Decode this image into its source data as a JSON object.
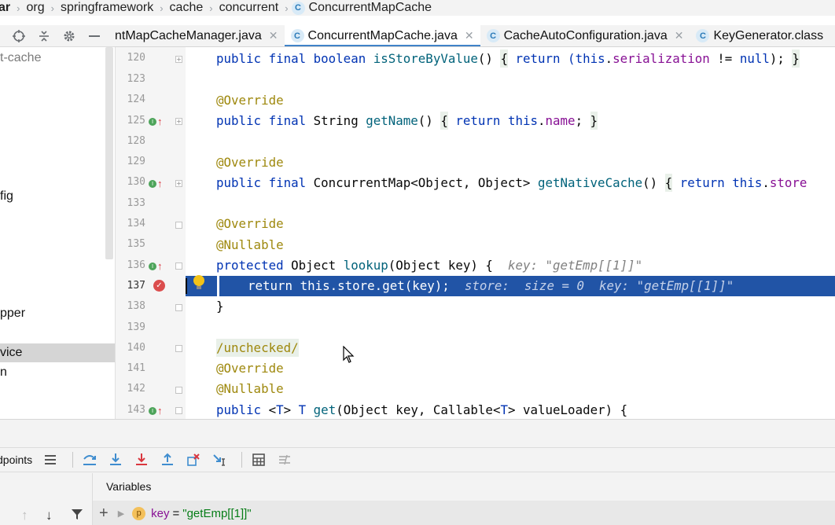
{
  "breadcrumb": [
    "ar",
    "org",
    "springframework",
    "cache",
    "concurrent",
    "ConcurrentMapCache"
  ],
  "tabs": [
    {
      "label": "ntMapCacheManager.java",
      "active": false
    },
    {
      "label": "ConcurrentMapCache.java",
      "active": true
    },
    {
      "label": "CacheAutoConfiguration.java",
      "active": false
    },
    {
      "label": "KeyGenerator.class",
      "active": false
    }
  ],
  "project_tree": {
    "items": [
      "t-cache",
      "fig",
      "pper",
      "vice",
      "n"
    ]
  },
  "gutter": {
    "line_numbers": [
      "120",
      "123",
      "124",
      "125",
      "128",
      "129",
      "130",
      "133",
      "134",
      "135",
      "136",
      "137",
      "138",
      "139",
      "140",
      "141",
      "142",
      "143"
    ]
  },
  "code": {
    "l120": {
      "p1": "public final boolean ",
      "fn": "isStoreByValue",
      "p2": "() ",
      "b1": "{",
      "p3": " return (",
      "kw_this": "this",
      "dot": ".",
      "fld": "serialization",
      "p4": " != ",
      "nul": "null",
      "p5": "); ",
      "b2": "}"
    },
    "l124": {
      "ann": "@Override"
    },
    "l125": {
      "kw": "public final ",
      "type": "String ",
      "fn": "getName",
      "p2": "() ",
      "b1": "{",
      "p3": " return ",
      "kw_this": "this",
      "dot": ".",
      "fld": "name",
      "p4": "; ",
      "b2": "}"
    },
    "l129": {
      "ann": "@Override"
    },
    "l130": {
      "kw": "public final ",
      "type": "ConcurrentMap<Object, Object> ",
      "fn": "getNativeCache",
      "p2": "() ",
      "b1": "{",
      "p3": " return ",
      "kw_this": "this",
      "dot": ".",
      "fld": "store"
    },
    "l134": {
      "ann": "@Override"
    },
    "l135": {
      "ann": "@Nullable"
    },
    "l136": {
      "kw": "protected ",
      "type": "Object ",
      "fn": "lookup",
      "p2": "(Object key) {",
      "hint": "key: \"getEmp[[1]]\""
    },
    "l137": {
      "code": "return this.store.get(key);",
      "hint": "store:  size = 0  key: \"getEmp[[1]]\""
    },
    "l138": {
      "text": "}"
    },
    "l140": {
      "ann": "/unchecked/"
    },
    "l141": {
      "ann": "@Override"
    },
    "l142": {
      "ann": "@Nullable"
    },
    "l143": {
      "kw": "public ",
      "generic_open": "<",
      "tparam": "T",
      "generic_close": "> ",
      "tparam2": "T ",
      "fn": "get",
      "p2": "(Object key, Callable<",
      "tparam3": "T",
      "p3": "> valueLoader) {"
    }
  },
  "debug": {
    "tab_label": "dpoints",
    "variables_header": "Variables",
    "variable": {
      "name": "key",
      "eq": "=",
      "value": "\"getEmp[[1]]\"",
      "icon": "p"
    }
  },
  "icons": {
    "class_icon_letter": "C",
    "override_marker": "overriding-method-icon",
    "breakpoint": "breakpoint-icon",
    "bulb": "intention-bulb-icon"
  },
  "colors": {
    "keyword": "#0033b3",
    "annotation": "#9e880d",
    "function": "#00627a",
    "field": "#871094",
    "execution_line": "#2154a6",
    "string": "#067d17"
  }
}
